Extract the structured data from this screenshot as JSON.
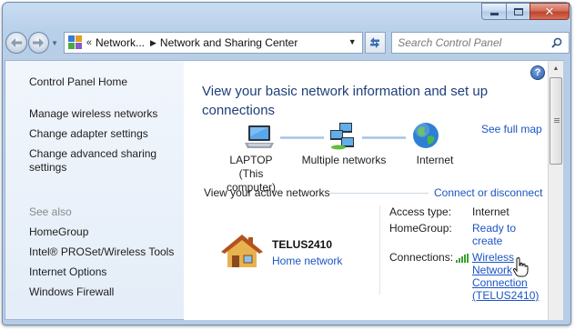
{
  "window": {
    "caption": {
      "minimize": "—",
      "maximize": "□",
      "close": "✕"
    }
  },
  "navbar": {
    "back_icon": "back-arrow-icon",
    "forward_icon": "forward-arrow-icon",
    "breadcrumb": {
      "overflow": "«",
      "items": [
        "Network...",
        "Network and Sharing Center"
      ]
    },
    "search_placeholder": "Search Control Panel"
  },
  "sidebar": {
    "home": "Control Panel Home",
    "items": [
      "Manage wireless networks",
      "Change adapter settings",
      "Change advanced sharing settings"
    ],
    "see_also_heading": "See also",
    "see_also": [
      "HomeGroup",
      "Intel® PROSet/Wireless Tools",
      "Internet Options",
      "Windows Firewall"
    ]
  },
  "main": {
    "title": "View your basic network information and set up connections",
    "see_full_map": "See full map",
    "map": {
      "nodes": [
        {
          "label": "LAPTOP",
          "sublabel": "(This computer)",
          "icon": "computer-icon"
        },
        {
          "label": "Multiple networks",
          "icon": "network-icon"
        },
        {
          "label": "Internet",
          "icon": "globe-icon"
        }
      ]
    },
    "active_networks_heading": "View your active networks",
    "connect_or_disconnect": "Connect or disconnect",
    "network": {
      "name": "TELUS2410",
      "type": "Home network",
      "icon": "house-icon",
      "access_type_label": "Access type:",
      "access_type_value": "Internet",
      "homegroup_label": "HomeGroup:",
      "homegroup_value": [
        "Ready to",
        "create"
      ],
      "connections_label": "Connections:",
      "connection_value": [
        "Wireless",
        "Network",
        "Connection",
        "(TELUS2410)"
      ],
      "connection_icon": "wireless-signal-icon"
    }
  },
  "colors": {
    "link": "#1a55c4",
    "title": "#1e3f7a",
    "sidebar_bg": "#e8f0fa",
    "chrome": "#b9d0ea"
  }
}
